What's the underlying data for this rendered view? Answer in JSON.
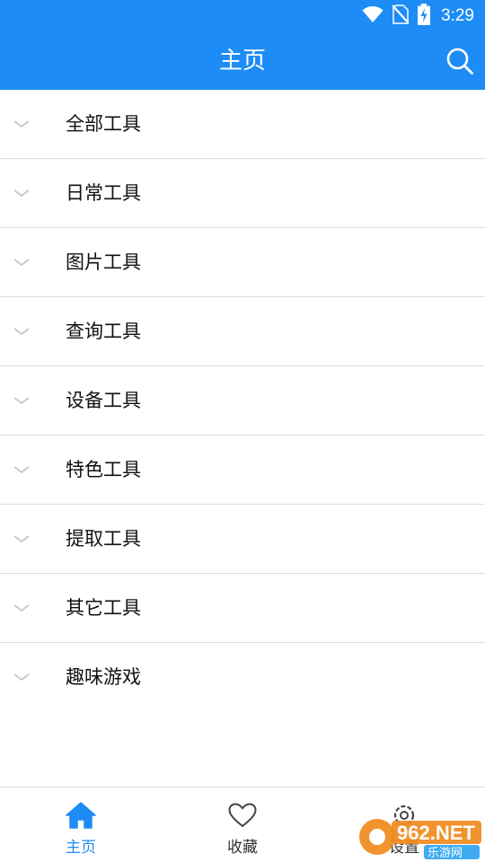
{
  "status_bar": {
    "time": "3:29",
    "icons": [
      "wifi-icon",
      "no-sim-icon",
      "battery-charging-icon"
    ]
  },
  "app_bar": {
    "title": "主页",
    "search_icon": "search-icon"
  },
  "categories": [
    {
      "label": "全部工具"
    },
    {
      "label": "日常工具"
    },
    {
      "label": "图片工具"
    },
    {
      "label": "查询工具"
    },
    {
      "label": "设备工具"
    },
    {
      "label": "特色工具"
    },
    {
      "label": "提取工具"
    },
    {
      "label": "其它工具"
    },
    {
      "label": "趣味游戏"
    }
  ],
  "bottom_nav": {
    "items": [
      {
        "label": "主页",
        "icon": "home-icon",
        "active": true
      },
      {
        "label": "收藏",
        "icon": "heart-icon",
        "active": false
      },
      {
        "label": "设置",
        "icon": "settings-icon",
        "active": false
      }
    ]
  },
  "watermark": {
    "brand": "962.NET",
    "sub": "乐游网"
  },
  "colors": {
    "accent": "#1e8cf6",
    "divider": "#dcdcdc",
    "chevron": "#c7c7c7",
    "text": "#111111"
  }
}
